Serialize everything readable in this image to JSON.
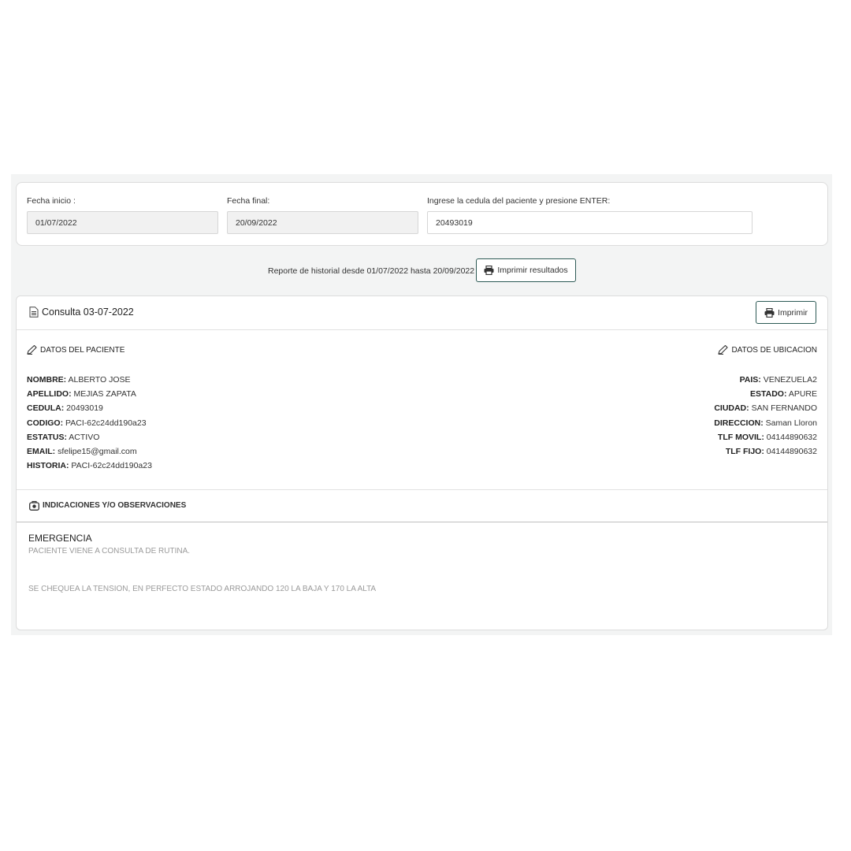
{
  "filters": {
    "start_label": "Fecha inicio :",
    "start_value": "01/07/2022",
    "end_label": "Fecha final:",
    "end_value": "20/09/2022",
    "cedula_label": "Ingrese la cedula del paciente y presione ENTER:",
    "cedula_value": "20493019"
  },
  "report": {
    "summary": "Reporte de historial desde 01/07/2022 hasta 20/09/2022",
    "print_results_label": "Imprimir resultados"
  },
  "consult": {
    "title": "Consulta 03-07-2022",
    "print_label": "Imprimir",
    "patient_section_title": "DATOS DEL PACIENTE",
    "location_section_title": "DATOS DE UBICACION",
    "patient": [
      {
        "key": "NOMBRE:",
        "value": "ALBERTO JOSE"
      },
      {
        "key": "APELLIDO:",
        "value": "MEJIAS ZAPATA"
      },
      {
        "key": "CEDULA:",
        "value": "20493019"
      },
      {
        "key": "CODIGO:",
        "value": "PACI-62c24dd190a23"
      },
      {
        "key": "ESTATUS:",
        "value": "ACTIVO"
      },
      {
        "key": "EMAIL:",
        "value": "sfelipe15@gmail.com"
      },
      {
        "key": "HISTORIA:",
        "value": "PACI-62c24dd190a23"
      }
    ],
    "location": [
      {
        "key": "PAIS:",
        "value": "VENEZUELA2"
      },
      {
        "key": "ESTADO:",
        "value": "APURE"
      },
      {
        "key": "CIUDAD:",
        "value": "SAN FERNANDO"
      },
      {
        "key": "DIRECCION:",
        "value": "Saman Lloron"
      },
      {
        "key": "TLF MOVIL:",
        "value": "04144890632"
      },
      {
        "key": "TLF FIJO:",
        "value": "04144890632"
      }
    ],
    "observations_title": "INDICACIONES Y/O OBSERVACIONES",
    "observation_type": "EMERGENCIA",
    "observation_line1": "PACIENTE VIENE A CONSULTA DE RUTINA.",
    "observation_line2": "SE CHEQUEA LA TENSION, EN PERFECTO ESTADO ARROJANDO 120 LA BAJA Y 170 LA ALTA"
  },
  "colors": {
    "button_border": "#2d5a55",
    "page_bg": "#f3f4f4"
  }
}
